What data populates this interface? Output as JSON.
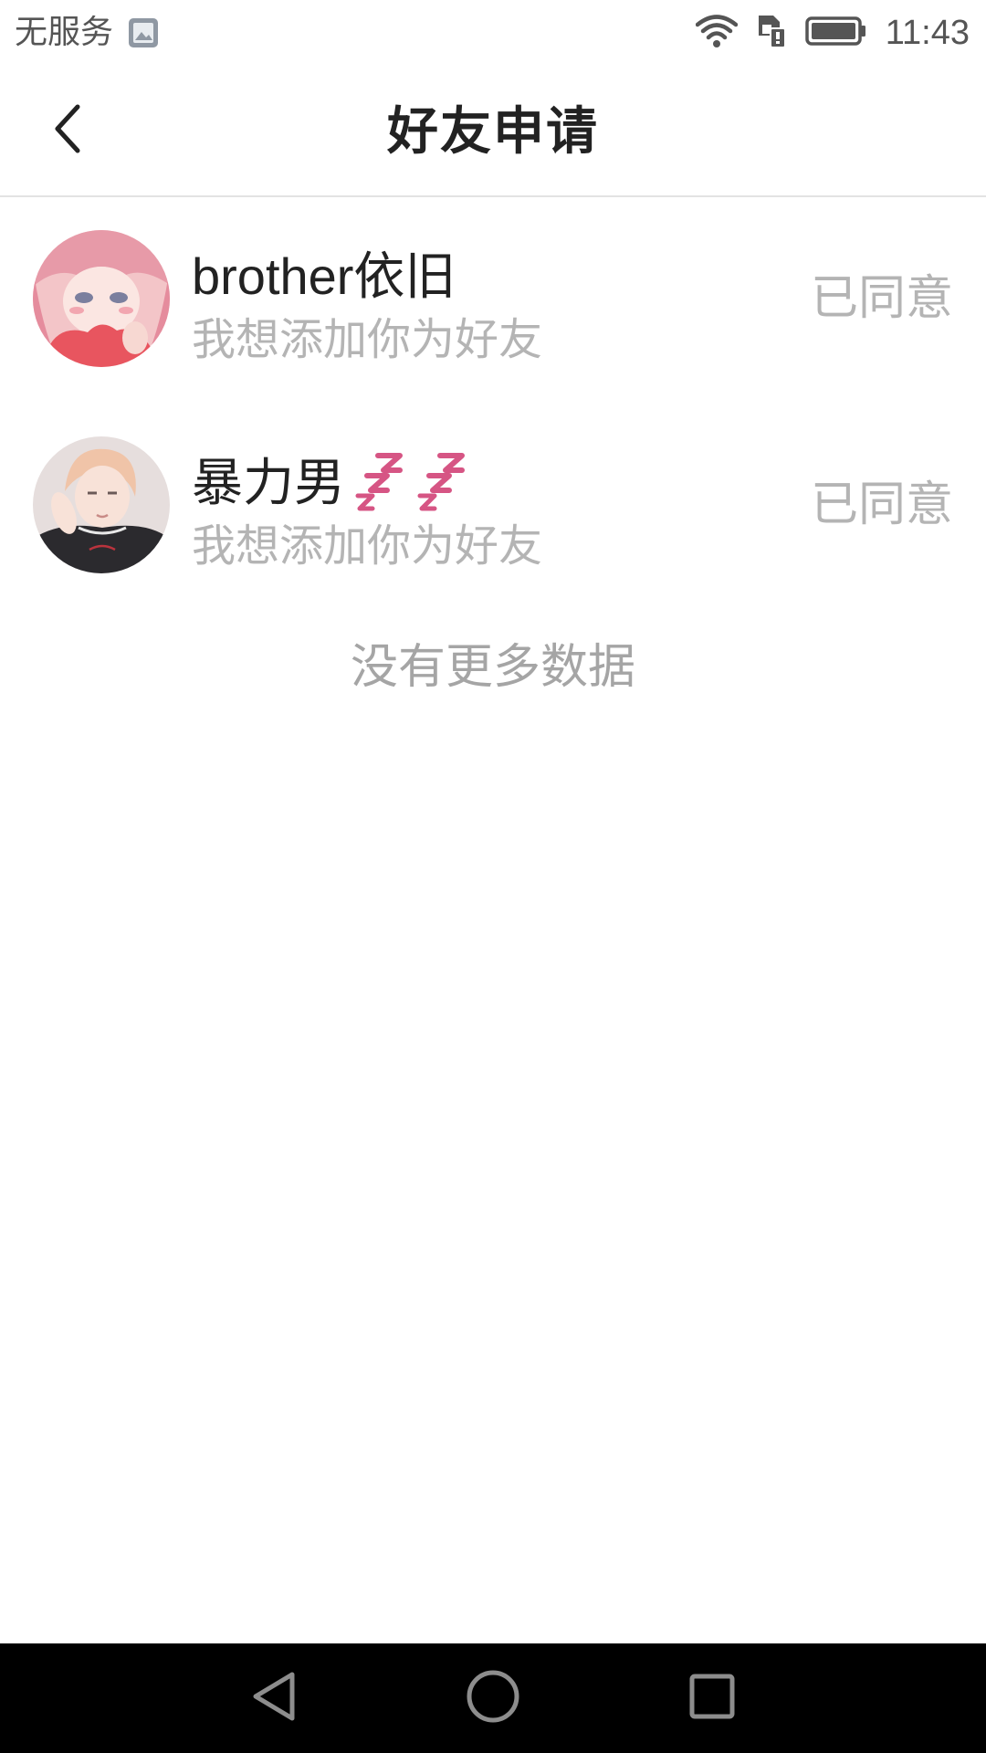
{
  "status_bar": {
    "carrier": "无服务",
    "time": "11:43",
    "icons": [
      "photo-icon",
      "wifi-icon",
      "sim-card-icon",
      "battery-icon"
    ]
  },
  "header": {
    "back_icon": "chevron-left-icon",
    "title": "好友申请"
  },
  "requests": [
    {
      "name": "brother依旧",
      "message": "我想添加你为好友",
      "status": "已同意",
      "avatar": "anime-girl-avatar"
    },
    {
      "name": "暴力男",
      "name_emoji": "zzz-sleep-icon",
      "message": "我想添加你为好友",
      "status": "已同意",
      "avatar": "anime-boy-avatar"
    }
  ],
  "footer_text": "没有更多数据",
  "nav_bar": {
    "buttons": [
      "back-triangle-icon",
      "home-circle-icon",
      "recents-square-icon"
    ]
  },
  "colors": {
    "muted_text": "#b4b4b4",
    "zzz_accent": "#d65584",
    "divider": "#e3e3e3"
  }
}
